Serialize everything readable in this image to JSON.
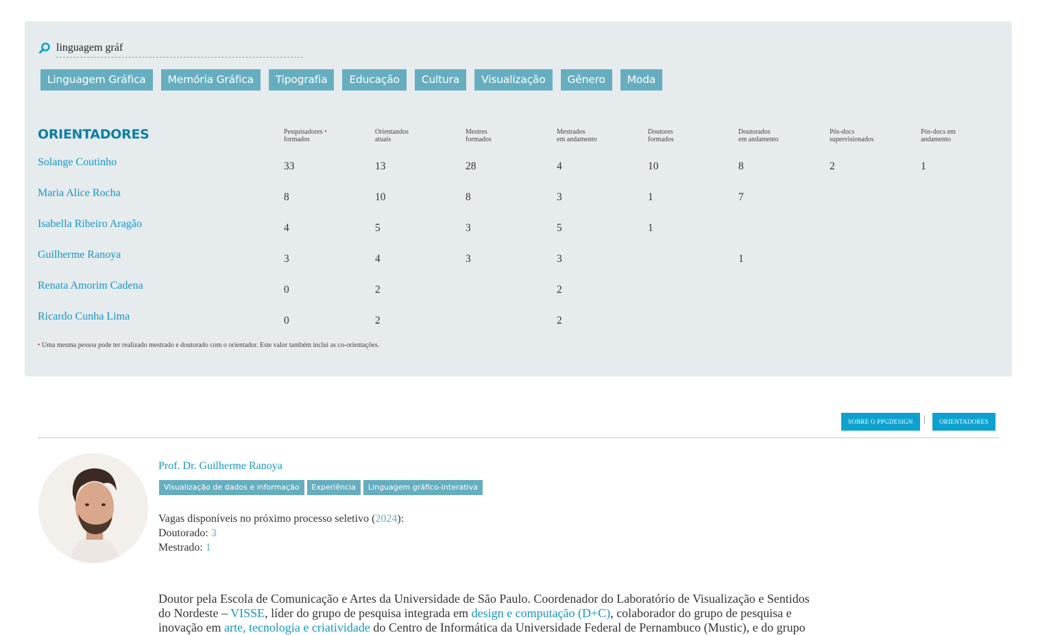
{
  "search": {
    "value": "linguagem gráf"
  },
  "tags": [
    "Linguagem Gráfica",
    "Memória Gráfica",
    "Tipografia",
    "Educação",
    "Cultura",
    "Visualização",
    "Gênero",
    "Moda"
  ],
  "table": {
    "title": "ORIENTADORES",
    "columns": [
      {
        "l1": "Pesquisadores",
        "l2": "formados",
        "star": "•"
      },
      {
        "l1": "Orientandos",
        "l2": "atuais"
      },
      {
        "l1": "Mestres",
        "l2": "formados"
      },
      {
        "l1": "Mestrados",
        "l2": "em andamento"
      },
      {
        "l1": "Doutores",
        "l2": "formados"
      },
      {
        "l1": "Doutorados",
        "l2": "em andamento"
      },
      {
        "l1": "Pós-docs",
        "l2": "supervisionados"
      },
      {
        "l1": "Pós-docs em",
        "l2": "andamento"
      }
    ],
    "rows": [
      {
        "name": "Solange Coutinho",
        "values": [
          "33",
          "13",
          "28",
          "4",
          "10",
          "8",
          "2",
          "1"
        ]
      },
      {
        "name": "Maria Alice Rocha",
        "values": [
          "8",
          "10",
          "8",
          "3",
          "1",
          "7",
          "",
          ""
        ]
      },
      {
        "name": "Isabella Ribeiro Aragão",
        "values": [
          "4",
          "5",
          "3",
          "5",
          "1",
          "",
          "",
          ""
        ]
      },
      {
        "name": "Guilherme Ranoya",
        "values": [
          "3",
          "4",
          "3",
          "3",
          "",
          "1",
          "",
          ""
        ]
      },
      {
        "name": "Renata Amorim Cadena",
        "values": [
          "0",
          "2",
          "",
          "2",
          "",
          "",
          "",
          ""
        ]
      },
      {
        "name": "Ricardo Cunha Lima",
        "values": [
          "0",
          "2",
          "",
          "2",
          "",
          "",
          "",
          ""
        ]
      }
    ],
    "footnote_star": "•",
    "footnote": "Uma mesma pessoa pode ter realizado mestrado e doutorado com o orientador. Este valor também inclui as co-orientações."
  },
  "nav": {
    "about": "SOBRE O PPGDESIGN",
    "separator": "|",
    "advisors": "ORIENTADORES"
  },
  "profile": {
    "name": "Prof. Dr. Guilherme Ranoya",
    "tags": [
      "Visualização de dados e informação",
      "Experiência",
      "Linguagem gráfico-interativa"
    ],
    "vagas_label": "Vagas disponíveis no próximo processo seletivo (",
    "vagas_year": "2024",
    "vagas_close": "):",
    "doutorado_label": "Doutorado: ",
    "doutorado_value": "3",
    "mestrado_label": "Mestrado: ",
    "mestrado_value": "1"
  },
  "bio": {
    "l1": "Doutor pela Escola de Comunicação e Artes da Universidade de São Paulo. Coordenador do Laboratório de Visualização e Sentidos",
    "l2a": "do Nordeste – ",
    "l2_link1": "VISSE",
    "l2b": ", líder do grupo de pesquisa integrada em ",
    "l2_link2": "design e computação (D+C)",
    "l2c": ", colaborador do grupo de pesquisa e",
    "l3a": "inovação em ",
    "l3_link": "arte, tecnologia e criatividade",
    "l3b": " do Centro de Informática da Universidade Federal de Pernambuco (Mustic), e do grupo"
  },
  "colors": {
    "accent": "#0ea1cf",
    "tag_bg": "#66aebf",
    "link": "#1597c0",
    "panel": "#e6ebee",
    "title": "#0e7fa0"
  }
}
